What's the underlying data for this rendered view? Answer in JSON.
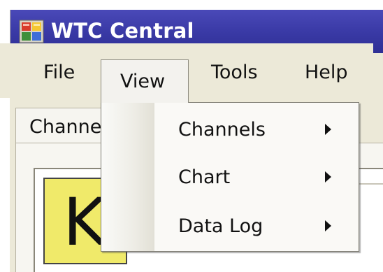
{
  "window": {
    "title": "WTC Central",
    "icon": "app-grid-icon"
  },
  "menubar": {
    "items": [
      {
        "label": "File"
      },
      {
        "label": "View"
      },
      {
        "label": "Tools"
      },
      {
        "label": "Help"
      }
    ],
    "open_menu": "View"
  },
  "tab": {
    "label": "Channels"
  },
  "panel": {
    "badge_letter": "K",
    "badge_color": "#f0ea6a"
  },
  "view_menu": {
    "items": [
      {
        "label": "Channels",
        "has_submenu": true,
        "icon": "submenu-arrow-icon"
      },
      {
        "label": "Chart",
        "has_submenu": true,
        "icon": "submenu-arrow-icon"
      },
      {
        "label": "Data Log",
        "has_submenu": true,
        "icon": "submenu-arrow-icon"
      }
    ]
  },
  "colors": {
    "titlebar": "#3a3aa6",
    "menu_background": "#ece9d8",
    "dropdown_background": "#faf9f6"
  }
}
